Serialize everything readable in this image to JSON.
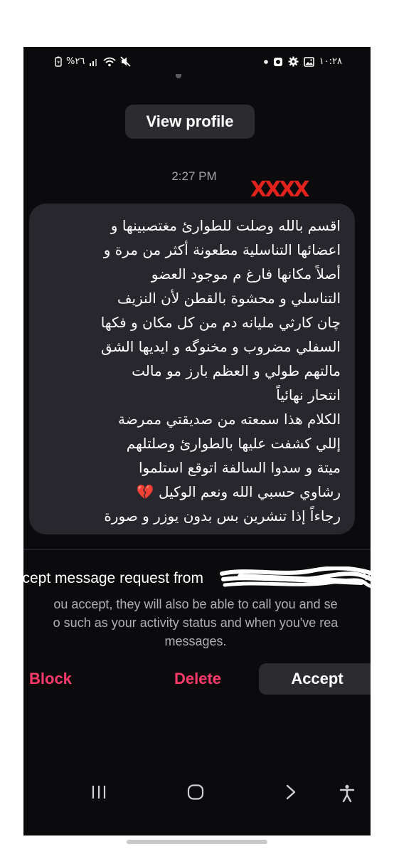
{
  "status_bar": {
    "left": {
      "battery_text": "%٢٦",
      "icons": [
        "battery-icon",
        "signal-icon",
        "wifi-icon",
        "mute-icon"
      ]
    },
    "right": {
      "time": "١٠:٢٨",
      "icons": [
        "dot-icon",
        "notification-icon",
        "settings-icon",
        "gallery-icon"
      ]
    }
  },
  "thread": {
    "view_profile_label": "View profile",
    "timestamp": "2:27 PM",
    "redaction_marks": "XXXX",
    "message": {
      "lines": [
        "اقسم بالله وصلت للطوارئ مغتصبينها و",
        "اعضائها التناسلية مطعونة أكثر من مرة و",
        "أصلاً مكانها فارغ م موجود العضو",
        "التناسلي و محشوة بالقطن لأن النزيف",
        "چان كارثي مليانه دم من كل مكان و فكها",
        "السفلي مضروب و مخنوگه و ايديها الشق",
        "مالتهم طولي و العظم بارز مو مالت",
        "انتحار نهائياً",
        "الكلام هذا سمعته من صديقتي ممرضة",
        "إللي كشفت عليها بالطوارئ وصلتلهم",
        "ميتة و سدوا السالفة اتوقع استلموا",
        "رشاوي حسبي الله ونعم الوكيل 💔",
        "رجاءاً إذا تنشرين بس بدون يوزر و صورة"
      ]
    }
  },
  "request": {
    "title": "ccept message request from",
    "title_tail": "?",
    "description_lines": [
      "ou accept, they will also be able to call you and se",
      "o such as your activity status and when you've rea",
      "messages."
    ],
    "actions": {
      "block_label": "Block",
      "delete_label": "Delete",
      "accept_label": "Accept"
    }
  },
  "nav_bar": {
    "items": [
      "recents-icon",
      "home-icon",
      "back-icon",
      "accessibility-icon"
    ]
  },
  "colors": {
    "screen_bg": "#0b0b0d",
    "bubble_bg": "#27272d",
    "button_bg": "#2b2b30",
    "danger": "#ff3b6b",
    "redaction_red": "#e2221c",
    "muted_text": "#a4a4aa"
  }
}
